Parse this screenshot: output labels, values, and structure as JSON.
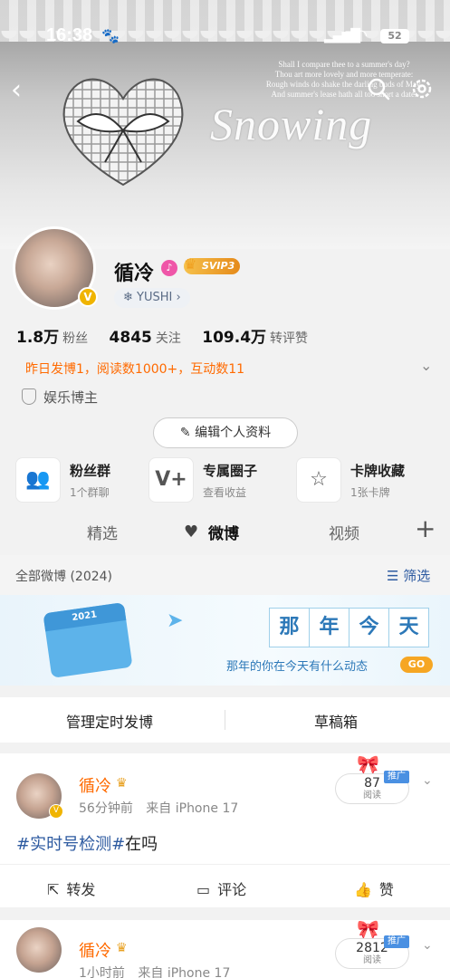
{
  "status": {
    "time": "16:38",
    "battery": "52"
  },
  "banner": {
    "poem": [
      "Shall I compare thee to a summer's day?",
      "Thou art more lovely and more temperate:",
      "Rough winds do shake the darling buds of May,",
      "And summer's lease hath all too short a date:"
    ],
    "title": "Snowing"
  },
  "profile": {
    "name": "循冷",
    "vip_label": "SVIP3",
    "tag": "YUSHI",
    "stats": [
      {
        "value": "1.8万",
        "label": "粉丝"
      },
      {
        "value": "4845",
        "label": "关注"
      },
      {
        "value": "109.4万",
        "label": "转评赞"
      }
    ],
    "activity": "昨日发博1，阅读数1000+，互动数11",
    "role": "娱乐博主",
    "edit_label": "编辑个人资料"
  },
  "quick": [
    {
      "title": "粉丝群",
      "sub": "1个群聊"
    },
    {
      "title": "专属圈子",
      "sub": "查看收益"
    },
    {
      "title": "卡牌收藏",
      "sub": "1张卡牌"
    }
  ],
  "tabs": [
    "精选",
    "微博",
    "视频"
  ],
  "filter": {
    "left": "全部微博 (2024)",
    "right": "筛选"
  },
  "memory": {
    "chars": [
      "那",
      "年",
      "今",
      "天"
    ],
    "sub": "那年的你在今天有什么动态",
    "go": "GO",
    "cal_year": "2021"
  },
  "manage": {
    "scheduled": "管理定时发博",
    "drafts": "草稿箱"
  },
  "posts": [
    {
      "name": "循冷",
      "time": "56分钟前",
      "from": "来自 iPhone 17",
      "reads": "87",
      "reads_label": "阅读",
      "promo": "推广",
      "tag": "#实时号检测#",
      "text": "在吗",
      "repost": "转发",
      "comment": "评论",
      "like": "赞"
    },
    {
      "name": "循冷",
      "time": "1小时前",
      "from": "来自 iPhone 17",
      "reads": "2812",
      "reads_label": "阅读",
      "promo": "推广"
    }
  ]
}
